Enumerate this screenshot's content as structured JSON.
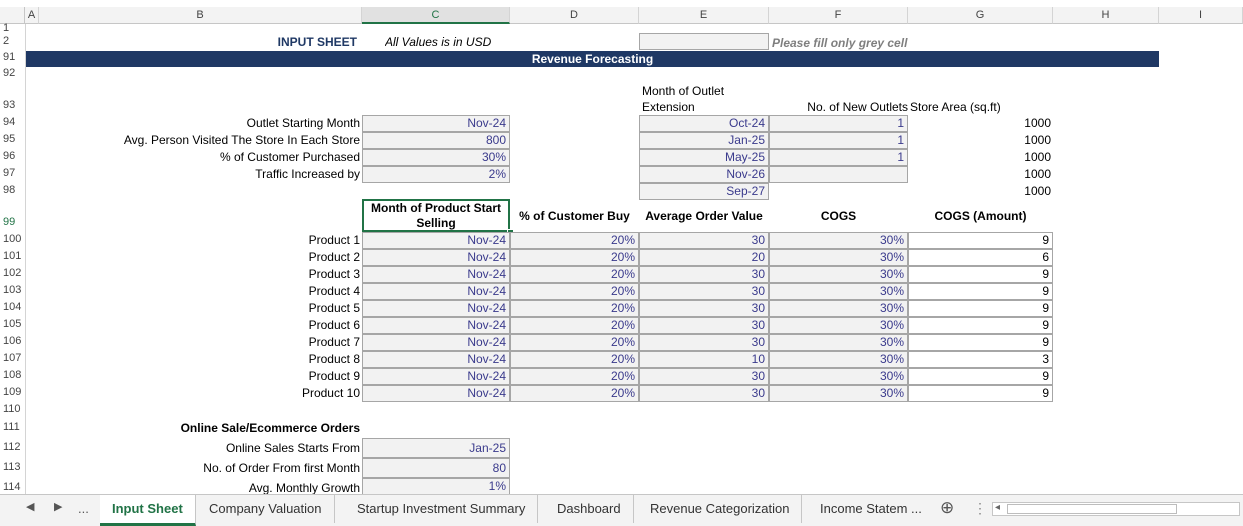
{
  "columns": [
    "A",
    "B",
    "C",
    "D",
    "E",
    "F",
    "G",
    "H",
    "I"
  ],
  "rows": [
    "1",
    "2",
    "91",
    "92",
    "93",
    "94",
    "95",
    "96",
    "97",
    "98",
    "99",
    "100",
    "101",
    "102",
    "103",
    "104",
    "105",
    "106",
    "107",
    "108",
    "109",
    "110",
    "111",
    "112",
    "113",
    "114"
  ],
  "header": {
    "input_sheet": "INPUT SHEET",
    "all_values": "All Values is in USD",
    "fill_note": "Please fill only grey cell",
    "banner": "Revenue Forecasting"
  },
  "outlet": {
    "labels": [
      "Outlet Starting Month",
      "Avg. Person Visited The Store In Each Store",
      "% of Customer Purchased",
      "Traffic Increased by"
    ],
    "values": [
      "Nov-24",
      "800",
      "30%",
      "2%"
    ]
  },
  "extension": {
    "head_line1": "Month of Outlet",
    "head_line2": "Extension",
    "new_outlets_head": "No. of New Outlets",
    "store_area_head": "Store Area (sq.ft)",
    "months": [
      "Oct-24",
      "Jan-25",
      "May-25",
      "Nov-26",
      "Sep-27"
    ],
    "new_outlets": [
      "1",
      "1",
      "1",
      "",
      ""
    ],
    "store_area": [
      "1000",
      "1000",
      "1000",
      "1000",
      "1000"
    ]
  },
  "products": {
    "headers": [
      "Month of Product Start Selling",
      "% of Customer Buy",
      "Average Order Value",
      "COGS",
      "COGS (Amount)"
    ],
    "rows": [
      {
        "name": "Product 1",
        "month": "Nov-24",
        "buy": "20%",
        "aov": "30",
        "cogs": "30%",
        "amount": "9"
      },
      {
        "name": "Product 2",
        "month": "Nov-24",
        "buy": "20%",
        "aov": "20",
        "cogs": "30%",
        "amount": "6"
      },
      {
        "name": "Product 3",
        "month": "Nov-24",
        "buy": "20%",
        "aov": "30",
        "cogs": "30%",
        "amount": "9"
      },
      {
        "name": "Product 4",
        "month": "Nov-24",
        "buy": "20%",
        "aov": "30",
        "cogs": "30%",
        "amount": "9"
      },
      {
        "name": "Product 5",
        "month": "Nov-24",
        "buy": "20%",
        "aov": "30",
        "cogs": "30%",
        "amount": "9"
      },
      {
        "name": "Product 6",
        "month": "Nov-24",
        "buy": "20%",
        "aov": "30",
        "cogs": "30%",
        "amount": "9"
      },
      {
        "name": "Product 7",
        "month": "Nov-24",
        "buy": "20%",
        "aov": "30",
        "cogs": "30%",
        "amount": "9"
      },
      {
        "name": "Product 8",
        "month": "Nov-24",
        "buy": "20%",
        "aov": "10",
        "cogs": "30%",
        "amount": "3"
      },
      {
        "name": "Product 9",
        "month": "Nov-24",
        "buy": "20%",
        "aov": "30",
        "cogs": "30%",
        "amount": "9"
      },
      {
        "name": "Product 10",
        "month": "Nov-24",
        "buy": "20%",
        "aov": "30",
        "cogs": "30%",
        "amount": "9"
      }
    ]
  },
  "online": {
    "title": "Online Sale/Ecommerce Orders",
    "labels": [
      "Online Sales Starts From",
      "No. of Order From first Month",
      "Avg. Monthly Growth"
    ],
    "values": [
      "Jan-25",
      "80",
      "1%"
    ]
  },
  "tabs": {
    "ellipsis": "...",
    "items": [
      "Input Sheet",
      "Company Valuation",
      "Startup Investment Summary",
      "Dashboard",
      "Revenue Categorization",
      "Income Statem ..."
    ],
    "add": "⊕",
    "more": "⋮"
  },
  "accent": "#217346",
  "banner_color": "#1f3864"
}
